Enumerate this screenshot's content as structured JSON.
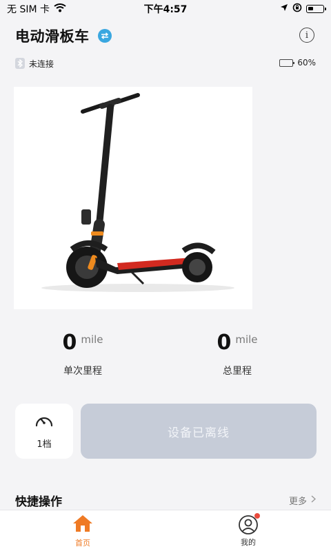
{
  "status_bar": {
    "carrier": "无 SIM 卡",
    "time": "下午4:57"
  },
  "header": {
    "title": "电动滑板车"
  },
  "connection": {
    "status": "未连接",
    "battery_percent_text": "60%",
    "battery_level": 0.6
  },
  "stats": [
    {
      "value": "0",
      "unit": "mile",
      "label": "单次里程"
    },
    {
      "value": "0",
      "unit": "mile",
      "label": "总里程"
    }
  ],
  "controls": {
    "gear_label": "1档",
    "offline_button": "设备已离线"
  },
  "quick_ops": {
    "title": "快捷操作",
    "more": "更多"
  },
  "tabbar": {
    "home": "首页",
    "me": "我的"
  },
  "colors": {
    "accent_orange": "#ef7a24",
    "switch_blue": "#3aa7e0",
    "offline_gray": "#c6ccd8",
    "battery_green": "#4fc36a",
    "notify_red": "#e94a3c"
  }
}
